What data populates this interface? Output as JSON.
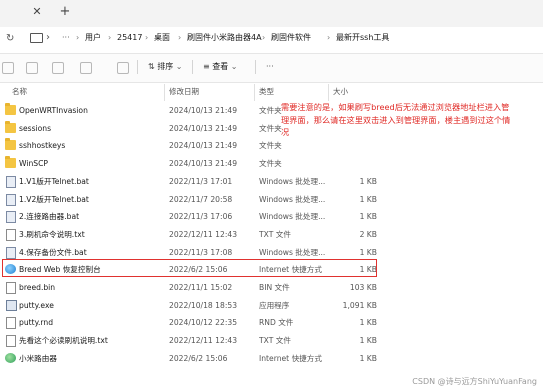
{
  "tab": {
    "close_glyph": "✕",
    "add_glyph": "+"
  },
  "address": {
    "crumbs": [
      "用户",
      "25417",
      "桌面",
      "刷固件小米路由器4A",
      "刷固件软件",
      "最新开ssh工具"
    ],
    "sep": "›",
    "more": "···"
  },
  "toolbar": {
    "sort_label": "排序",
    "view_label": "查看"
  },
  "columns": {
    "name": "名称",
    "date": "修改日期",
    "type": "类型",
    "size": "大小"
  },
  "files": [
    {
      "name": "OpenWRTInvasion",
      "date": "2024/10/13 21:49",
      "type": "文件夹",
      "size": "",
      "icon": "folder"
    },
    {
      "name": "sessions",
      "date": "2024/10/13 21:49",
      "type": "文件夹",
      "size": "",
      "icon": "folder"
    },
    {
      "name": "sshhostkeys",
      "date": "2024/10/13 21:49",
      "type": "文件夹",
      "size": "",
      "icon": "folder"
    },
    {
      "name": "WinSCP",
      "date": "2024/10/13 21:49",
      "type": "文件夹",
      "size": "",
      "icon": "folder"
    },
    {
      "name": "1.V1版开Telnet.bat",
      "date": "2022/11/3 17:01",
      "type": "Windows 批处理...",
      "size": "1 KB",
      "icon": "bat"
    },
    {
      "name": "1.V2版开Telnet.bat",
      "date": "2022/11/7 20:58",
      "type": "Windows 批处理...",
      "size": "1 KB",
      "icon": "bat"
    },
    {
      "name": "2.连接路由器.bat",
      "date": "2022/11/3 17:06",
      "type": "Windows 批处理...",
      "size": "1 KB",
      "icon": "bat"
    },
    {
      "name": "3.刷机命令说明.txt",
      "date": "2022/12/11 12:43",
      "type": "TXT 文件",
      "size": "2 KB",
      "icon": "txt"
    },
    {
      "name": "4.保存备份文件.bat",
      "date": "2022/11/3 17:08",
      "type": "Windows 批处理...",
      "size": "1 KB",
      "icon": "bat"
    },
    {
      "name": "Breed Web 恢复控制台",
      "date": "2022/6/2 15:06",
      "type": "Internet 快捷方式",
      "size": "1 KB",
      "icon": "shortcut"
    },
    {
      "name": "breed.bin",
      "date": "2022/11/1 15:02",
      "type": "BIN 文件",
      "size": "103 KB",
      "icon": "txt"
    },
    {
      "name": "putty.exe",
      "date": "2022/10/18 18:53",
      "type": "应用程序",
      "size": "1,091 KB",
      "icon": "exe"
    },
    {
      "name": "putty.rnd",
      "date": "2024/10/12 22:35",
      "type": "RND 文件",
      "size": "1 KB",
      "icon": "txt"
    },
    {
      "name": "先看这个必读刷机说明.txt",
      "date": "2022/12/11 12:43",
      "type": "TXT 文件",
      "size": "1 KB",
      "icon": "txt"
    },
    {
      "name": "小米路由器",
      "date": "2022/6/2 15:06",
      "type": "Internet 快捷方式",
      "size": "1 KB",
      "icon": "mishortcut"
    }
  ],
  "annotation": {
    "text": "需要注意的是，如果刷写breed后无法通过浏览器地址栏进入管理界面，那么请在这里双击进入到管理界面，楼主遇到过这个情况",
    "color": "#e02b27"
  },
  "watermark": "CSDN @诗与远方ShiYuYuanFang"
}
